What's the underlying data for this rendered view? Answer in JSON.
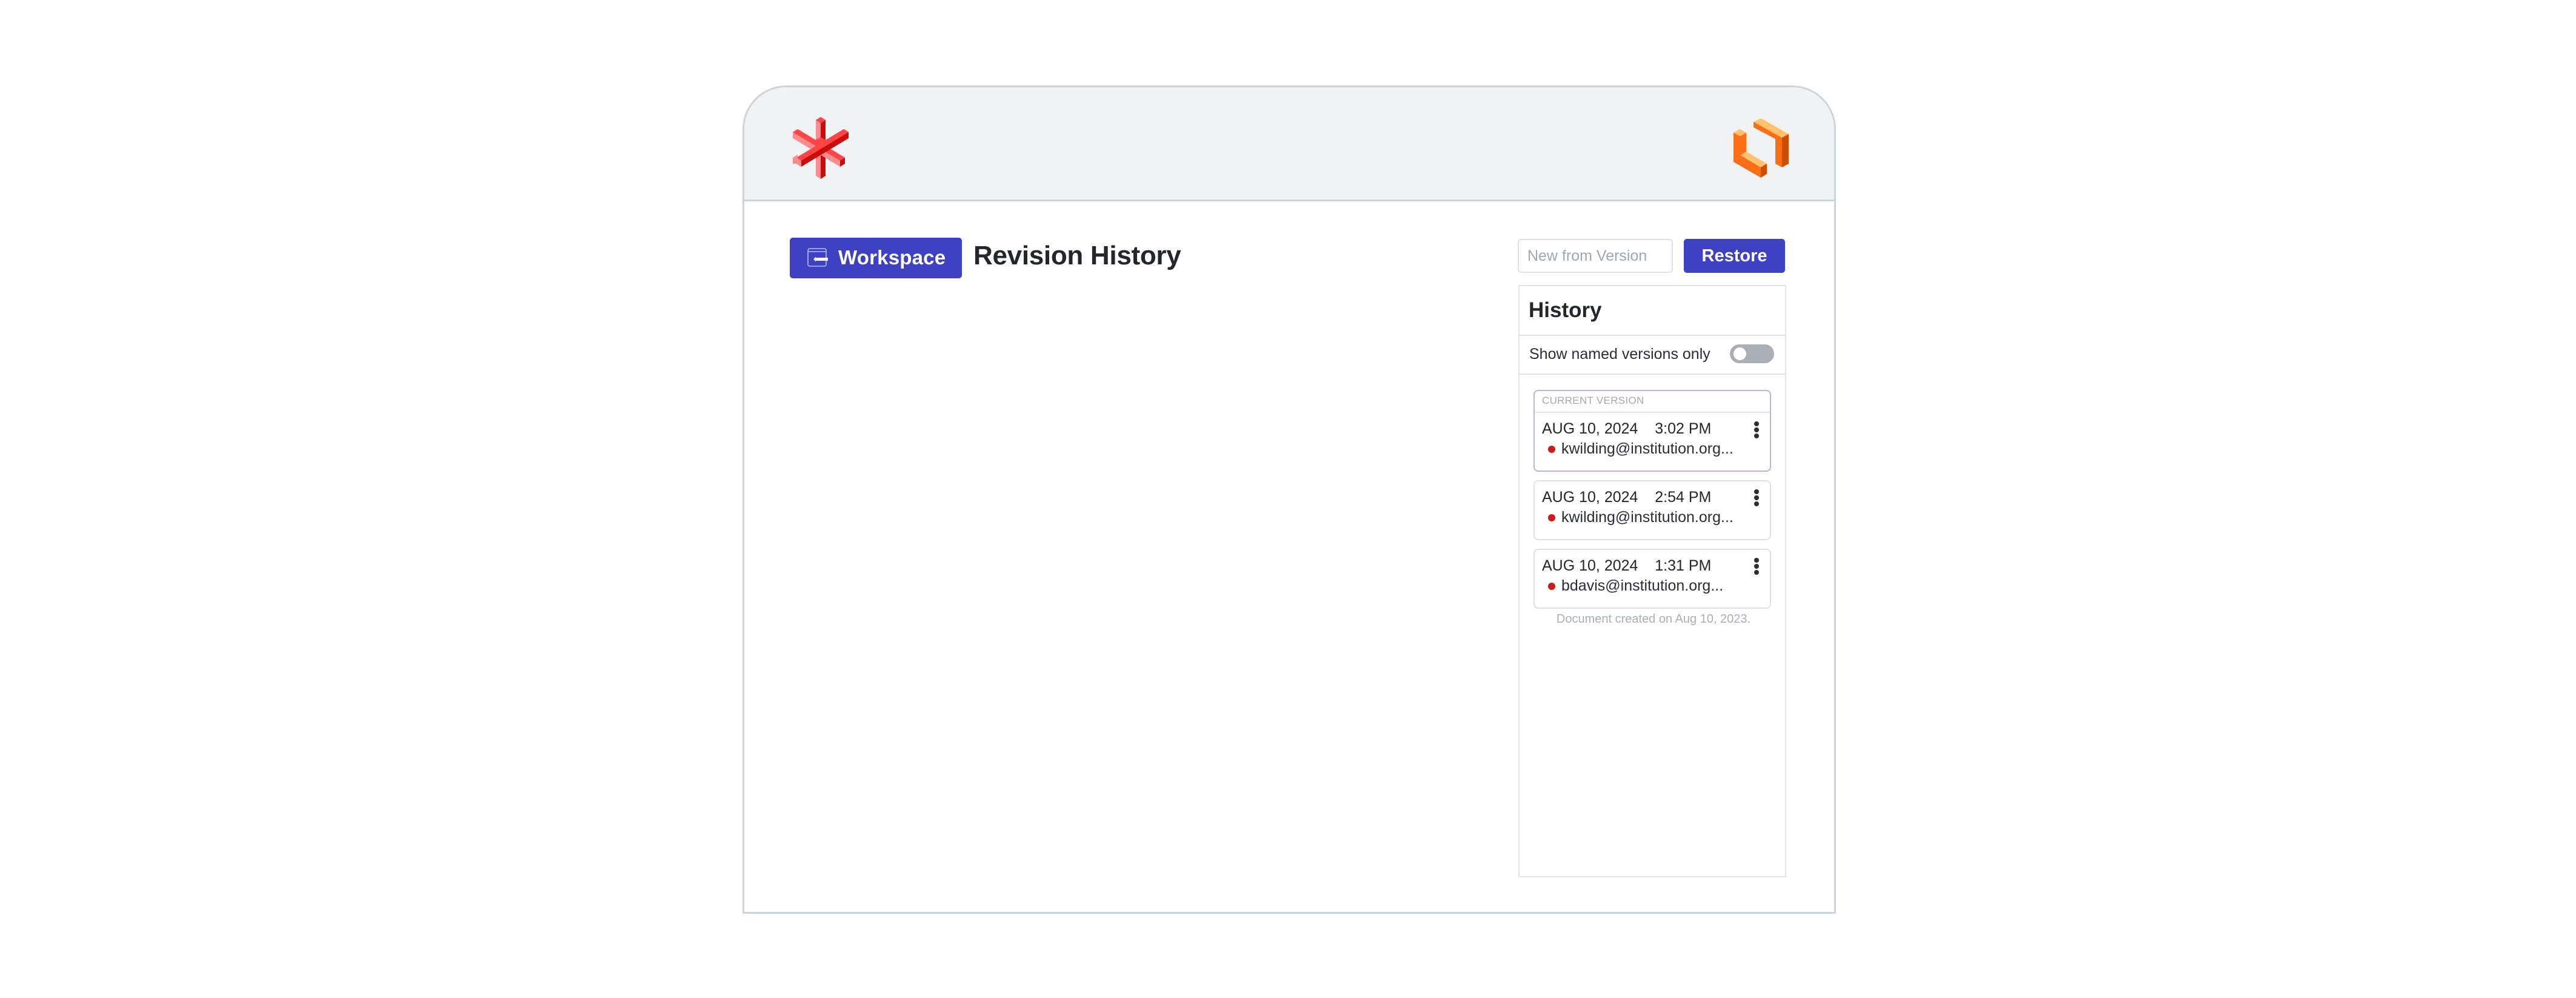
{
  "header": {
    "left_logo": "red-asterisk-logo",
    "right_logo": "orange-brackets-logo"
  },
  "toolbar": {
    "workspace_label": "Workspace",
    "workspace_icon": "exit-panel-arrow-icon",
    "page_title": "Revision History",
    "new_from_version_placeholder": "New from Version",
    "new_from_version_value": "",
    "restore_label": "Restore"
  },
  "history": {
    "title": "History",
    "filter_label": "Show named versions only",
    "filter_enabled": false,
    "current_label": "CURRENT VERSION",
    "versions": [
      {
        "date": "AUG 10, 2024",
        "time": "3:02 PM",
        "author": "kwilding@institution.org...",
        "current": true
      },
      {
        "date": "AUG 10, 2024",
        "time": "2:54 PM",
        "author": "kwilding@institution.org...",
        "current": false
      },
      {
        "date": "AUG 10, 2024",
        "time": "1:31 PM",
        "author": "bdavis@institution.org...",
        "current": false
      }
    ],
    "created_note": "Document created on Aug 10, 2023."
  },
  "colors": {
    "accent": "#3e41c2",
    "author_dot": "#cc1b1b",
    "topbar_bg": "#f1f2f4",
    "toggle_off": "#a9aeb7"
  }
}
